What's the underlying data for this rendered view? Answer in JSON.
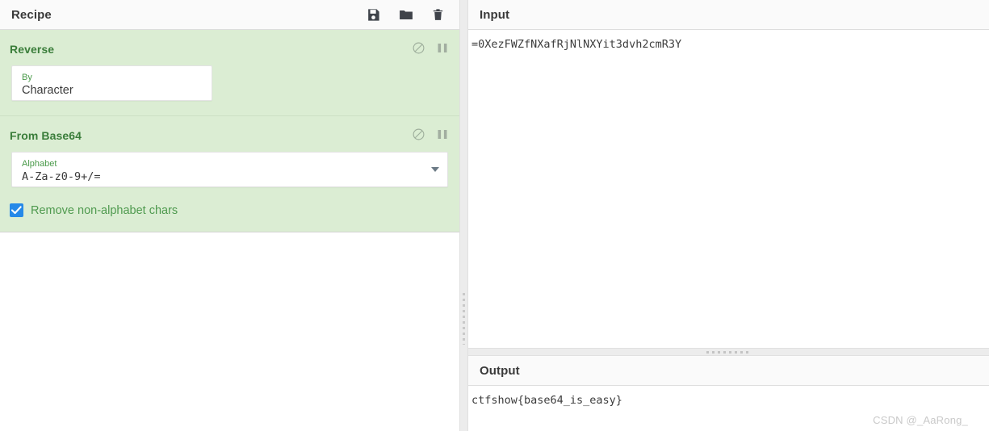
{
  "recipe": {
    "title": "Recipe",
    "toolbar": [
      {
        "name": "save-recipe-button",
        "icon": "save-icon",
        "label": "Save recipe"
      },
      {
        "name": "load-recipe-button",
        "icon": "folder-icon",
        "label": "Load recipe"
      },
      {
        "name": "clear-recipe-button",
        "icon": "trash-icon",
        "label": "Clear recipe"
      }
    ],
    "operations": [
      {
        "name": "Reverse",
        "disable_icon_label": "Disable operation",
        "breakpoint_icon_label": "Set breakpoint",
        "args": [
          {
            "type": "select",
            "label": "By",
            "value": "Character"
          }
        ],
        "checkboxes": []
      },
      {
        "name": "From Base64",
        "disable_icon_label": "Disable operation",
        "breakpoint_icon_label": "Set breakpoint",
        "args": [
          {
            "type": "select",
            "label": "Alphabet",
            "value": "A-Za-z0-9+/="
          }
        ],
        "checkboxes": [
          {
            "label": "Remove non-alphabet chars",
            "checked": true
          }
        ]
      }
    ]
  },
  "input": {
    "title": "Input",
    "value": "=0XezFWZfNXafRjNlNXYit3dvh2cmR3Y"
  },
  "output": {
    "title": "Output",
    "value": "ctfshow{base64_is_easy}"
  },
  "watermark": "CSDN @_AaRong_",
  "colors": {
    "recipe_bg": "#dbedd3",
    "op_title": "#3a7d3a",
    "field_label": "#4a9a4a",
    "checkbox_accent": "#2589e8",
    "panel_header_bg": "#fafafa"
  }
}
